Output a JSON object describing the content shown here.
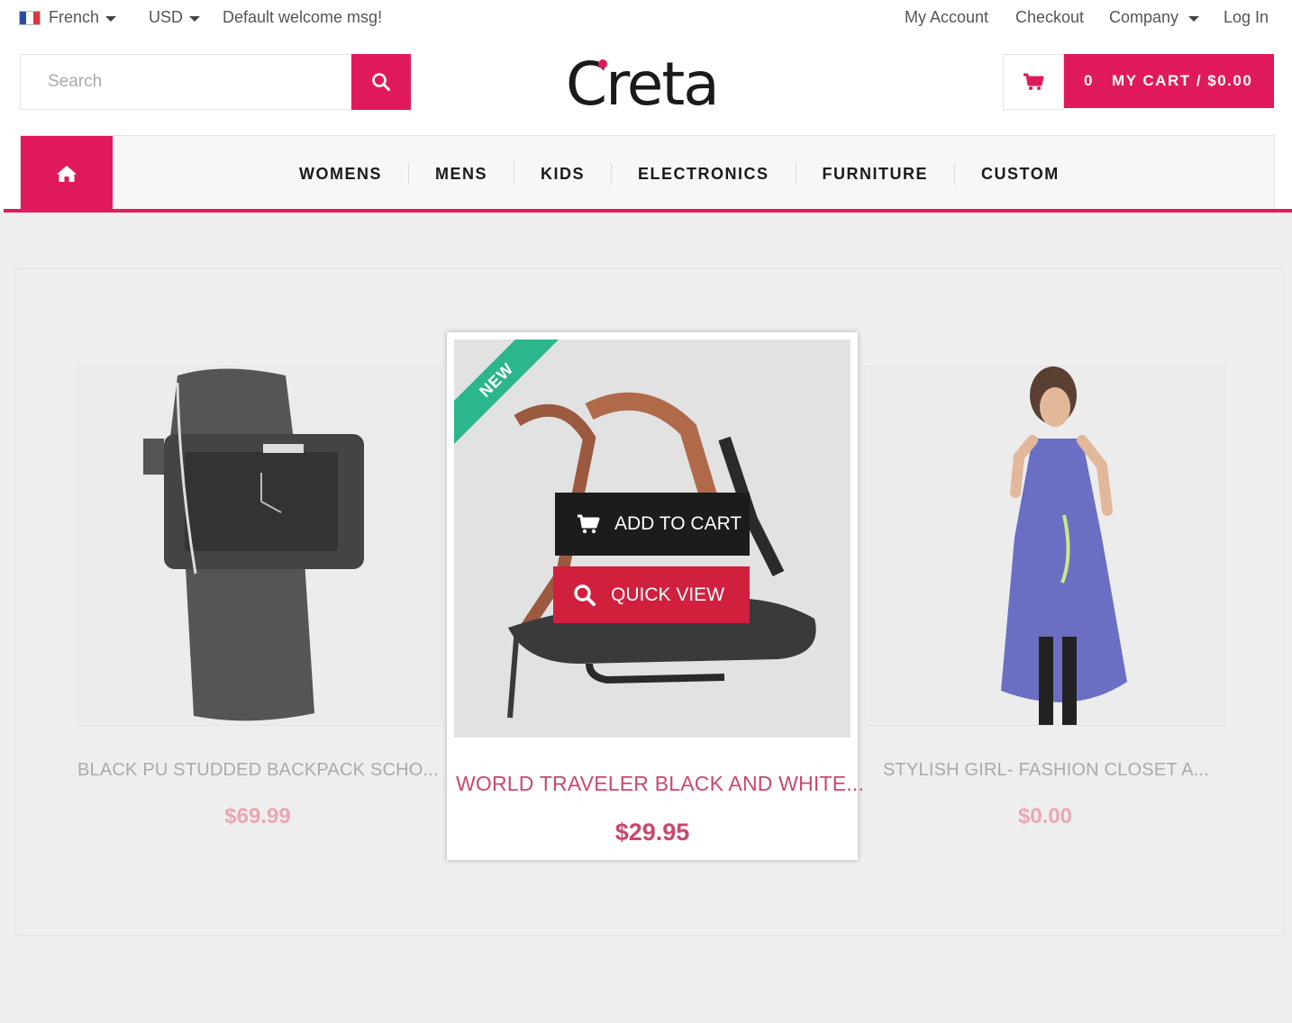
{
  "topbar": {
    "language": "French",
    "currency": "USD",
    "welcome": "Default welcome msg!",
    "links": [
      "My Account",
      "Checkout",
      "Company",
      "Log In"
    ]
  },
  "search": {
    "placeholder": "Search"
  },
  "logo": {
    "text": "Creta",
    "accent_color": "#e01a5a"
  },
  "cart": {
    "count": "0",
    "label": "MY CART / $0.00"
  },
  "nav": {
    "items": [
      "WOMENS",
      "MENS",
      "KIDS",
      "ELECTRONICS",
      "FURNITURE",
      "CUSTOM"
    ]
  },
  "products": [
    {
      "name": "BLACK PU STUDDED BACKPACK SCHO...",
      "price": "$69.99"
    },
    {
      "name": "WORLD TRAVELER BLACK AND WHITE...",
      "price": "$29.95",
      "badge": "NEW",
      "actions": {
        "add_to_cart": "ADD TO CART",
        "quick_view": "QUICK VIEW"
      }
    },
    {
      "name": "STYLISH GIRL- FASHION CLOSET A...",
      "price": "$0.00"
    }
  ],
  "colors": {
    "brand": "#e01a5a",
    "badge": "#2bb68e",
    "quick_view": "#d0203e",
    "add_to_cart": "#1c1c1c"
  },
  "icons": [
    "flag-icon",
    "caret-down-icon",
    "search-icon",
    "cart-icon",
    "home-icon"
  ]
}
